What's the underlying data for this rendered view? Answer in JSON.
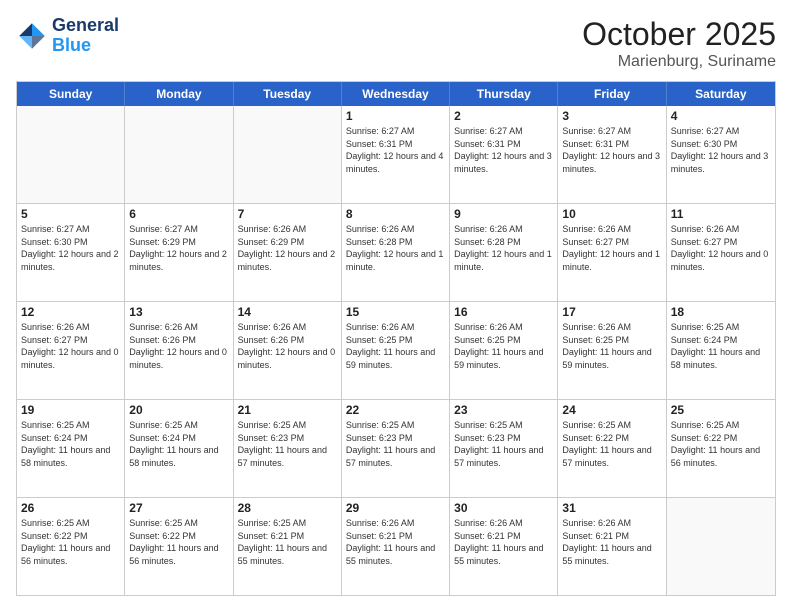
{
  "header": {
    "logo_general": "General",
    "logo_blue": "Blue",
    "month_title": "October 2025",
    "subtitle": "Marienburg, Suriname"
  },
  "weekdays": [
    "Sunday",
    "Monday",
    "Tuesday",
    "Wednesday",
    "Thursday",
    "Friday",
    "Saturday"
  ],
  "rows": [
    [
      {
        "day": "",
        "info": ""
      },
      {
        "day": "",
        "info": ""
      },
      {
        "day": "",
        "info": ""
      },
      {
        "day": "1",
        "info": "Sunrise: 6:27 AM\nSunset: 6:31 PM\nDaylight: 12 hours\nand 4 minutes."
      },
      {
        "day": "2",
        "info": "Sunrise: 6:27 AM\nSunset: 6:31 PM\nDaylight: 12 hours\nand 3 minutes."
      },
      {
        "day": "3",
        "info": "Sunrise: 6:27 AM\nSunset: 6:31 PM\nDaylight: 12 hours\nand 3 minutes."
      },
      {
        "day": "4",
        "info": "Sunrise: 6:27 AM\nSunset: 6:30 PM\nDaylight: 12 hours\nand 3 minutes."
      }
    ],
    [
      {
        "day": "5",
        "info": "Sunrise: 6:27 AM\nSunset: 6:30 PM\nDaylight: 12 hours\nand 2 minutes."
      },
      {
        "day": "6",
        "info": "Sunrise: 6:27 AM\nSunset: 6:29 PM\nDaylight: 12 hours\nand 2 minutes."
      },
      {
        "day": "7",
        "info": "Sunrise: 6:26 AM\nSunset: 6:29 PM\nDaylight: 12 hours\nand 2 minutes."
      },
      {
        "day": "8",
        "info": "Sunrise: 6:26 AM\nSunset: 6:28 PM\nDaylight: 12 hours\nand 1 minute."
      },
      {
        "day": "9",
        "info": "Sunrise: 6:26 AM\nSunset: 6:28 PM\nDaylight: 12 hours\nand 1 minute."
      },
      {
        "day": "10",
        "info": "Sunrise: 6:26 AM\nSunset: 6:27 PM\nDaylight: 12 hours\nand 1 minute."
      },
      {
        "day": "11",
        "info": "Sunrise: 6:26 AM\nSunset: 6:27 PM\nDaylight: 12 hours\nand 0 minutes."
      }
    ],
    [
      {
        "day": "12",
        "info": "Sunrise: 6:26 AM\nSunset: 6:27 PM\nDaylight: 12 hours\nand 0 minutes."
      },
      {
        "day": "13",
        "info": "Sunrise: 6:26 AM\nSunset: 6:26 PM\nDaylight: 12 hours\nand 0 minutes."
      },
      {
        "day": "14",
        "info": "Sunrise: 6:26 AM\nSunset: 6:26 PM\nDaylight: 12 hours\nand 0 minutes."
      },
      {
        "day": "15",
        "info": "Sunrise: 6:26 AM\nSunset: 6:25 PM\nDaylight: 11 hours\nand 59 minutes."
      },
      {
        "day": "16",
        "info": "Sunrise: 6:26 AM\nSunset: 6:25 PM\nDaylight: 11 hours\nand 59 minutes."
      },
      {
        "day": "17",
        "info": "Sunrise: 6:26 AM\nSunset: 6:25 PM\nDaylight: 11 hours\nand 59 minutes."
      },
      {
        "day": "18",
        "info": "Sunrise: 6:25 AM\nSunset: 6:24 PM\nDaylight: 11 hours\nand 58 minutes."
      }
    ],
    [
      {
        "day": "19",
        "info": "Sunrise: 6:25 AM\nSunset: 6:24 PM\nDaylight: 11 hours\nand 58 minutes."
      },
      {
        "day": "20",
        "info": "Sunrise: 6:25 AM\nSunset: 6:24 PM\nDaylight: 11 hours\nand 58 minutes."
      },
      {
        "day": "21",
        "info": "Sunrise: 6:25 AM\nSunset: 6:23 PM\nDaylight: 11 hours\nand 57 minutes."
      },
      {
        "day": "22",
        "info": "Sunrise: 6:25 AM\nSunset: 6:23 PM\nDaylight: 11 hours\nand 57 minutes."
      },
      {
        "day": "23",
        "info": "Sunrise: 6:25 AM\nSunset: 6:23 PM\nDaylight: 11 hours\nand 57 minutes."
      },
      {
        "day": "24",
        "info": "Sunrise: 6:25 AM\nSunset: 6:22 PM\nDaylight: 11 hours\nand 57 minutes."
      },
      {
        "day": "25",
        "info": "Sunrise: 6:25 AM\nSunset: 6:22 PM\nDaylight: 11 hours\nand 56 minutes."
      }
    ],
    [
      {
        "day": "26",
        "info": "Sunrise: 6:25 AM\nSunset: 6:22 PM\nDaylight: 11 hours\nand 56 minutes."
      },
      {
        "day": "27",
        "info": "Sunrise: 6:25 AM\nSunset: 6:22 PM\nDaylight: 11 hours\nand 56 minutes."
      },
      {
        "day": "28",
        "info": "Sunrise: 6:25 AM\nSunset: 6:21 PM\nDaylight: 11 hours\nand 55 minutes."
      },
      {
        "day": "29",
        "info": "Sunrise: 6:26 AM\nSunset: 6:21 PM\nDaylight: 11 hours\nand 55 minutes."
      },
      {
        "day": "30",
        "info": "Sunrise: 6:26 AM\nSunset: 6:21 PM\nDaylight: 11 hours\nand 55 minutes."
      },
      {
        "day": "31",
        "info": "Sunrise: 6:26 AM\nSunset: 6:21 PM\nDaylight: 11 hours\nand 55 minutes."
      },
      {
        "day": "",
        "info": ""
      }
    ]
  ]
}
